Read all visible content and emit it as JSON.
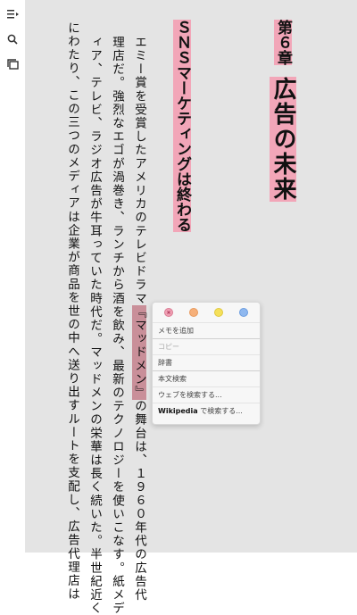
{
  "sidebar": {
    "icons": [
      "toc-icon",
      "search-icon",
      "pages-icon"
    ]
  },
  "chapter": {
    "label": "第６章",
    "title": "広告の未来"
  },
  "section_title": "ＳＮＳマーケティングは終わる",
  "body_columns": [
    "エミー賞を受賞したアメリカのテレビドラマ",
    "理店だ。強烈なエゴが渦巻き、ランチから酒を飲み、",
    "ィア、テレビ、ラジオ広告が牛耳っていた時代だ。",
    "にわたり、この三つのメディアは企業が商品を世の中へ送り出すルートを支配し、"
  ],
  "body_col1_selected": "『マッドメン』",
  "body_col1_rest": "の舞台は、１９６０年代の広告代",
  "body_col2_rest": "最新のテクノロジーを使いこなす。紙メデ",
  "body_col3_rest": "マッドメンの栄華は長く続いた。半世紀近く",
  "body_col4_rest": "広告代理店は",
  "context_menu": {
    "colors": [
      "#f0a0b4",
      "#f6b07a",
      "#f5e05a",
      "#8fb8ef"
    ],
    "items": {
      "add_memo": "メモを追加",
      "copy": "コピー",
      "dictionary": "辞書",
      "search_text": "本文検索",
      "search_web": "ウェブを検索する...",
      "wikipedia_brand": "Wikipedia",
      "wikipedia_rest": " で検索する..."
    }
  }
}
